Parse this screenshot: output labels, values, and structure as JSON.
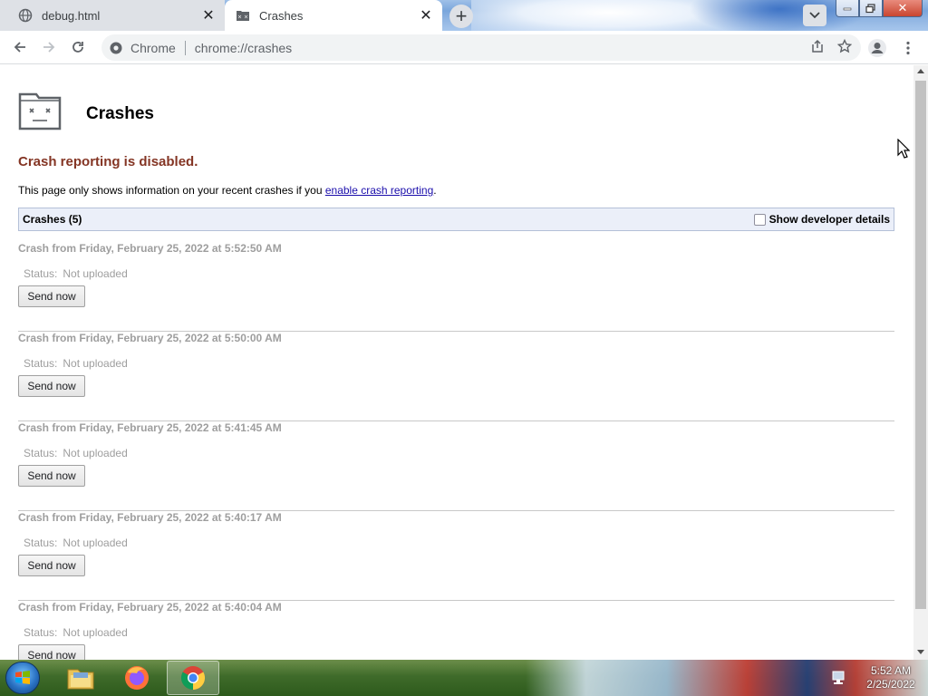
{
  "browser": {
    "tabs": [
      {
        "title": "debug.html",
        "active": false
      },
      {
        "title": "Crashes",
        "active": true
      }
    ],
    "address": {
      "scheme_label": "Chrome",
      "url": "chrome://crashes"
    }
  },
  "page": {
    "title": "Crashes",
    "disabled_message": "Crash reporting is disabled.",
    "info_prefix": "This page only shows information on your recent crashes if you ",
    "info_link": "enable crash reporting",
    "info_suffix": ".",
    "list_header": "Crashes (5)",
    "dev_details_label": "Show developer details",
    "crashes": [
      {
        "title": "Crash from Friday, February 25, 2022 at 5:52:50 AM",
        "status_label": "Status:",
        "status_value": "Not uploaded",
        "button": "Send now"
      },
      {
        "title": "Crash from Friday, February 25, 2022 at 5:50:00 AM",
        "status_label": "Status:",
        "status_value": "Not uploaded",
        "button": "Send now"
      },
      {
        "title": "Crash from Friday, February 25, 2022 at 5:41:45 AM",
        "status_label": "Status:",
        "status_value": "Not uploaded",
        "button": "Send now"
      },
      {
        "title": "Crash from Friday, February 25, 2022 at 5:40:17 AM",
        "status_label": "Status:",
        "status_value": "Not uploaded",
        "button": "Send now"
      },
      {
        "title": "Crash from Friday, February 25, 2022 at 5:40:04 AM",
        "status_label": "Status:",
        "status_value": "Not uploaded",
        "button": "Send now"
      }
    ]
  },
  "taskbar": {
    "time": "5:52 AM",
    "date": "2/25/2022"
  },
  "colors": {
    "disabled_text": "#843524",
    "link": "#1a0dab",
    "header_bg": "#ebeff9",
    "muted_text": "#9e9e9e"
  }
}
